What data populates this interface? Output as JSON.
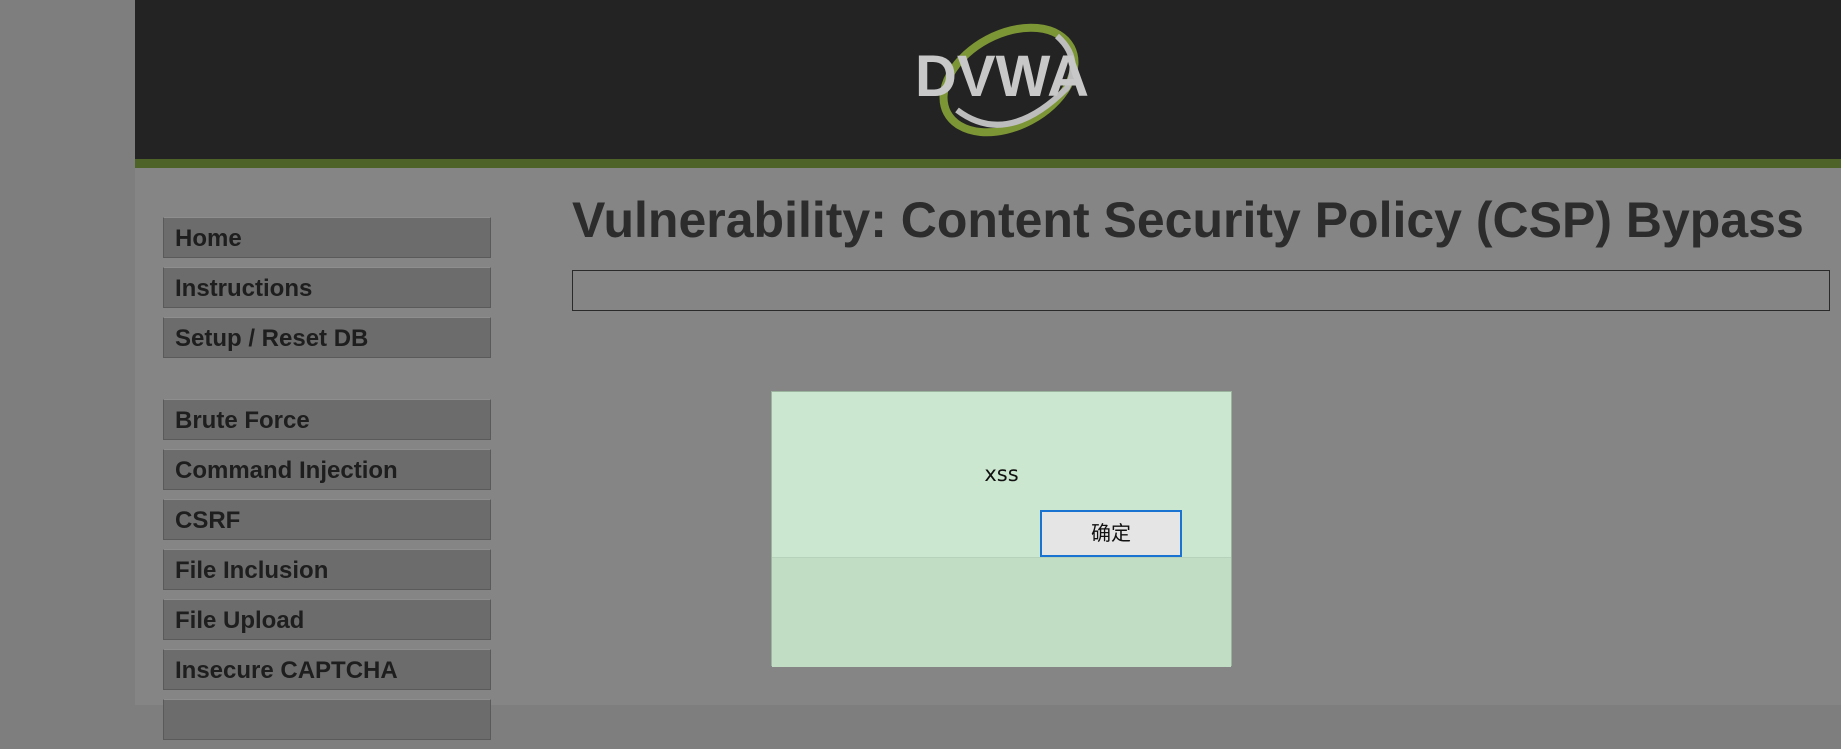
{
  "header": {
    "logo_text": "DVWA",
    "colors": {
      "background": "#232323",
      "stripe": "#4d6327"
    }
  },
  "sidebar": {
    "group1": [
      {
        "label": "Home"
      },
      {
        "label": "Instructions"
      },
      {
        "label": "Setup / Reset DB"
      }
    ],
    "group2": [
      {
        "label": "Brute Force"
      },
      {
        "label": "Command Injection"
      },
      {
        "label": "CSRF"
      },
      {
        "label": "File Inclusion"
      },
      {
        "label": "File Upload"
      },
      {
        "label": "Insecure CAPTCHA"
      }
    ]
  },
  "main": {
    "title": "Vulnerability: Content Security Policy (CSP) Bypass",
    "info_box_text": ""
  },
  "dialog": {
    "message": "xss",
    "ok_label": "确定",
    "colors": {
      "background": "#cce7cf",
      "button_border": "#1a73d0"
    }
  }
}
